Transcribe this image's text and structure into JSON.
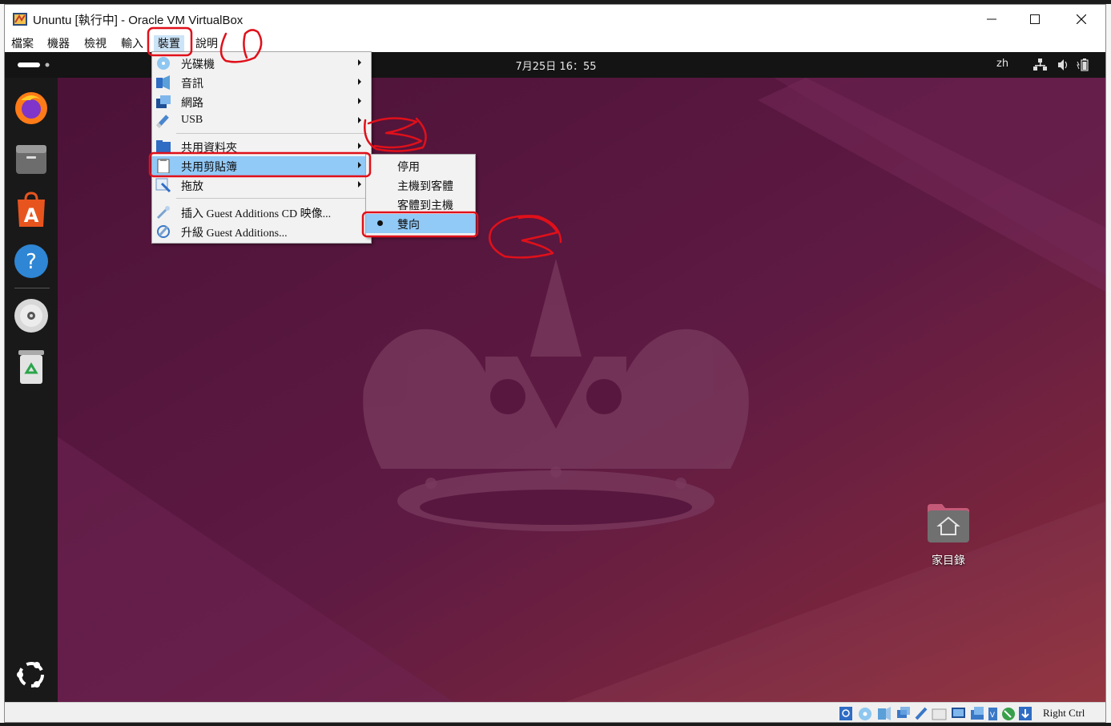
{
  "window": {
    "title": "Ununtu [執行中] - Oracle VM VirtualBox",
    "minimize_glyph": "—",
    "close_glyph": "✕"
  },
  "menubar": [
    {
      "label": "檔案"
    },
    {
      "label": "機器"
    },
    {
      "label": "檢視"
    },
    {
      "label": "輸入"
    },
    {
      "label": "裝置"
    },
    {
      "label": "說明"
    }
  ],
  "devices_menu": {
    "items": [
      {
        "label": "光碟機",
        "icon": "optical-disc-icon",
        "submenu": true
      },
      {
        "label": "音訊",
        "icon": "audio-icon",
        "submenu": true
      },
      {
        "label": "網路",
        "icon": "network-icon",
        "submenu": true
      },
      {
        "label": "USB",
        "icon": "usb-icon",
        "submenu": true
      },
      {
        "label": "共用資料夾",
        "icon": "shared-folder-icon",
        "submenu": true
      },
      {
        "label": "共用剪貼簿",
        "icon": "clipboard-icon",
        "submenu": true,
        "highlighted": true
      },
      {
        "label": "拖放",
        "icon": "drag-drop-icon",
        "submenu": true
      },
      {
        "label": "插入 Guest Additions CD 映像...",
        "icon": "insert-cd-icon"
      },
      {
        "label": "升級 Guest Additions...",
        "icon": "upgrade-icon"
      }
    ]
  },
  "clipboard_submenu": {
    "items": [
      {
        "label": "停用"
      },
      {
        "label": "主機到客體"
      },
      {
        "label": "客體到主機"
      },
      {
        "label": "雙向",
        "selected": true
      }
    ]
  },
  "guest": {
    "clock": "7月25日 16：55",
    "lang": "zh",
    "desktop_icon_label": "家目錄",
    "dock": [
      "firefox-icon",
      "files-icon",
      "app-center-icon",
      "help-icon",
      "dvd-icon",
      "trash-icon",
      "show-apps-icon"
    ]
  },
  "statusbar": {
    "host_key": "Right Ctrl"
  },
  "annotations": [
    "1",
    "2",
    "3"
  ],
  "colors": {
    "highlight": "#91c9f7",
    "annotation": "#e0101a",
    "wallpaper": "#57173f"
  }
}
